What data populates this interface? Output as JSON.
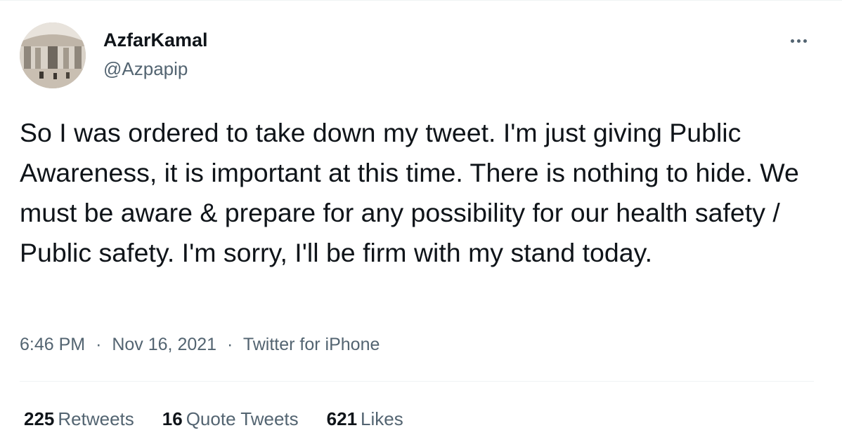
{
  "tweet": {
    "author": {
      "display_name": "AzfarKamal",
      "handle": "@Azpapip"
    },
    "text": "So I was ordered to take down my tweet. I'm just giving Public Awareness, it is important at this time. There is nothing to hide. We must be aware & prepare for any possibility for our health safety / Public safety. I'm sorry, I'll be firm with my stand today.",
    "time": "6:46 PM",
    "separator": "·",
    "date": "Nov 16, 2021",
    "source": "Twitter for iPhone",
    "stats": {
      "retweets": {
        "count": "225",
        "label": "Retweets"
      },
      "quote_tweets": {
        "count": "16",
        "label": "Quote Tweets"
      },
      "likes": {
        "count": "621",
        "label": "Likes"
      }
    }
  },
  "icons": {
    "more": "more-horizontal-icon"
  },
  "colors": {
    "text_primary": "#0f1419",
    "text_secondary": "#536471",
    "divider": "#eff3f4",
    "background": "#ffffff"
  }
}
